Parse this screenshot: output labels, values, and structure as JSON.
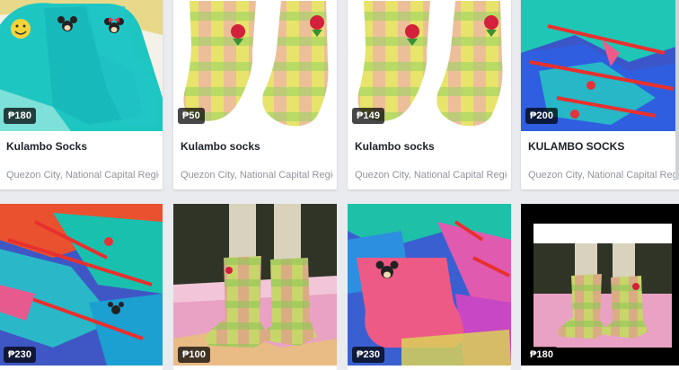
{
  "listings": [
    {
      "price": "₱180",
      "title": "Kulambo Socks",
      "location": "Quezon City, National Capital Region · ..."
    },
    {
      "price": "₱50",
      "title": "Kulambo socks",
      "location": "Quezon City, National Capital Region · ..."
    },
    {
      "price": "₱149",
      "title": "Kulambo socks",
      "location": "Quezon City, National Capital Region · ..."
    },
    {
      "price": "₱200",
      "title": "KULAMBO SOCKS",
      "location": "Quezon City, National Capital Region · ..."
    },
    {
      "price": "₱230"
    },
    {
      "price": "₱100"
    },
    {
      "price": "₱230"
    },
    {
      "price": "₱180"
    }
  ],
  "colors": {
    "background": "#e9ebee",
    "title": "#1d2129",
    "location": "#90949c",
    "price_badge": "#000000"
  },
  "icons": [
    "smiley-patch-icon",
    "mickey-patch-icon",
    "minnie-patch-icon",
    "rose-patch-icon",
    "strawberry-patch-icon"
  ]
}
